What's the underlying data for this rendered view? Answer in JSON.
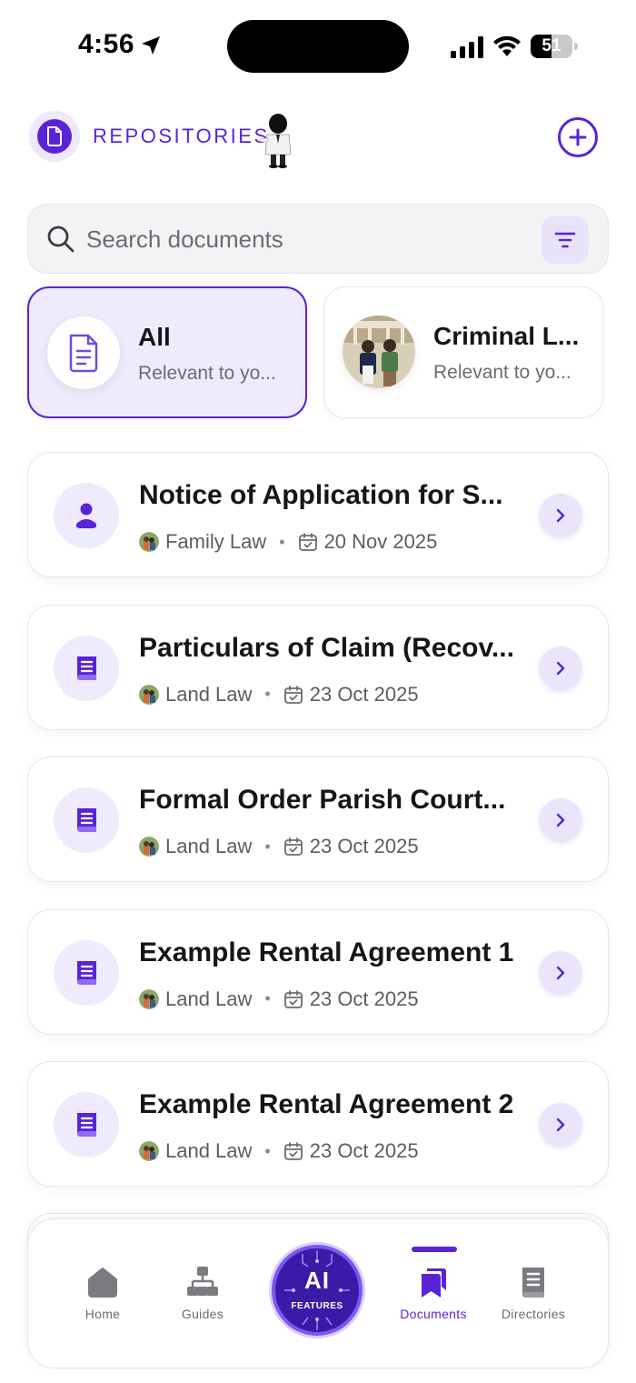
{
  "status_bar": {
    "time": "4:56",
    "battery_level": 51,
    "battery_text": "51"
  },
  "header": {
    "title": "REPOSITORIES",
    "add_label": "+"
  },
  "search": {
    "placeholder": "Search documents",
    "value": ""
  },
  "categories": [
    {
      "name": "All",
      "subtitle": "Relevant to yo...",
      "active": true,
      "icon": "document-icon"
    },
    {
      "name": "Criminal L...",
      "subtitle": "Relevant to yo...",
      "active": false,
      "icon": "criminal-law-photo"
    }
  ],
  "documents": [
    {
      "title": "Notice of Application for S...",
      "category": "Family Law",
      "date": "20 Nov 2025",
      "icon": "person-icon"
    },
    {
      "title": "Particulars of Claim (Recov...",
      "category": "Land Law",
      "date": "23 Oct 2025",
      "icon": "book-icon"
    },
    {
      "title": "Formal Order Parish Court...",
      "category": "Land Law",
      "date": "23 Oct 2025",
      "icon": "book-icon"
    },
    {
      "title": "Example Rental Agreement 1",
      "category": "Land Law",
      "date": "23 Oct 2025",
      "icon": "book-icon"
    },
    {
      "title": "Example Rental Agreement 2",
      "category": "Land Law",
      "date": "23 Oct 2025",
      "icon": "book-icon"
    }
  ],
  "nav": {
    "home": "Home",
    "guides": "Guides",
    "ai_title": "AI",
    "ai_subtitle": "FEATURES",
    "documents": "Documents",
    "directories": "Directories",
    "active": "documents"
  },
  "colors": {
    "accent": "#5a23d6",
    "accent_light": "#efeafc",
    "text_muted": "#6b6b72"
  }
}
